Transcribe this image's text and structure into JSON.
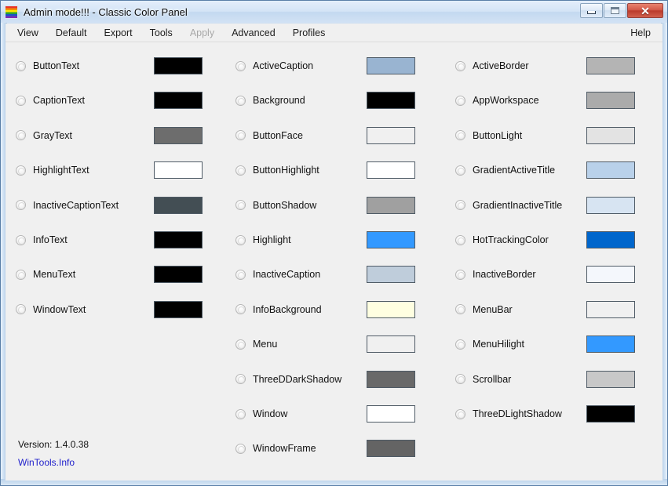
{
  "window": {
    "title": "Admin mode!!! - Classic Color Panel",
    "app_icon": "rainbow-palette-icon",
    "controls": {
      "minimize": "minimize-icon",
      "maximize": "maximize-icon",
      "close": "✕"
    }
  },
  "menubar": {
    "items": [
      {
        "label": "View",
        "disabled": false
      },
      {
        "label": "Default",
        "disabled": false
      },
      {
        "label": "Export",
        "disabled": false
      },
      {
        "label": "Tools",
        "disabled": false
      },
      {
        "label": "Apply",
        "disabled": true
      },
      {
        "label": "Advanced",
        "disabled": false
      },
      {
        "label": "Profiles",
        "disabled": false
      }
    ],
    "help": "Help"
  },
  "columns": [
    {
      "name": "text-colors-column",
      "rows": [
        {
          "label": "ButtonText",
          "color": "#000000"
        },
        {
          "label": "CaptionText",
          "color": "#000000"
        },
        {
          "label": "GrayText",
          "color": "#6d6d6d"
        },
        {
          "label": "HighlightText",
          "color": "#ffffff"
        },
        {
          "label": "InactiveCaptionText",
          "color": "#434e54"
        },
        {
          "label": "InfoText",
          "color": "#000000"
        },
        {
          "label": "MenuText",
          "color": "#000000"
        },
        {
          "label": "WindowText",
          "color": "#000000"
        }
      ]
    },
    {
      "name": "surface-colors-column",
      "rows": [
        {
          "label": "ActiveCaption",
          "color": "#99b4d1"
        },
        {
          "label": "Background",
          "color": "#000000"
        },
        {
          "label": "ButtonFace",
          "color": "#f0f0f0"
        },
        {
          "label": "ButtonHighlight",
          "color": "#ffffff"
        },
        {
          "label": "ButtonShadow",
          "color": "#a0a0a0"
        },
        {
          "label": "Highlight",
          "color": "#3399ff"
        },
        {
          "label": "InactiveCaption",
          "color": "#bfcddb"
        },
        {
          "label": "InfoBackground",
          "color": "#ffffe1"
        },
        {
          "label": "Menu",
          "color": "#f0f0f0"
        },
        {
          "label": "ThreeDDarkShadow",
          "color": "#696969"
        },
        {
          "label": "Window",
          "color": "#ffffff"
        },
        {
          "label": "WindowFrame",
          "color": "#646464"
        }
      ]
    },
    {
      "name": "border-colors-column",
      "rows": [
        {
          "label": "ActiveBorder",
          "color": "#b4b4b4"
        },
        {
          "label": "AppWorkspace",
          "color": "#ababab"
        },
        {
          "label": "ButtonLight",
          "color": "#e3e3e3"
        },
        {
          "label": "GradientActiveTitle",
          "color": "#b9d1ea"
        },
        {
          "label": "GradientInactiveTitle",
          "color": "#d7e4f2"
        },
        {
          "label": "HotTrackingColor",
          "color": "#0066cc"
        },
        {
          "label": "InactiveBorder",
          "color": "#f4f7fc"
        },
        {
          "label": "MenuBar",
          "color": "#f0f0f0"
        },
        {
          "label": "MenuHilight",
          "color": "#3399ff"
        },
        {
          "label": "Scrollbar",
          "color": "#c8c8c8"
        },
        {
          "label": "ThreeDLightShadow",
          "color": "#000000"
        }
      ]
    }
  ],
  "footer": {
    "version": "Version: 1.4.0.38",
    "link": "WinTools.Info"
  }
}
